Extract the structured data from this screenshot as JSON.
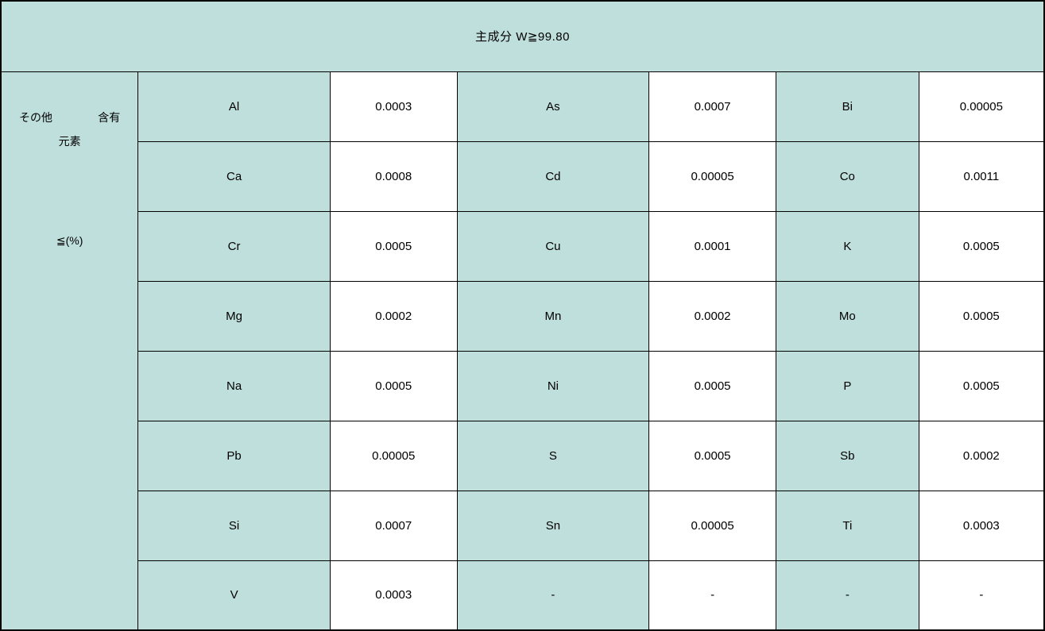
{
  "header": {
    "title": "主成分  W≧99.80"
  },
  "sideLabel": {
    "line1a": "その他",
    "line1b": "含有",
    "line2": "元素",
    "line3": "≦(%)"
  },
  "rows": [
    {
      "e1": "Al",
      "v1": "0.0003",
      "e2": "As",
      "v2": "0.0007",
      "e3": "Bi",
      "v3": "0.00005"
    },
    {
      "e1": "Ca",
      "v1": "0.0008",
      "e2": "Cd",
      "v2": "0.00005",
      "e3": "Co",
      "v3": "0.0011"
    },
    {
      "e1": "Cr",
      "v1": "0.0005",
      "e2": "Cu",
      "v2": "0.0001",
      "e3": "K",
      "v3": "0.0005"
    },
    {
      "e1": "Mg",
      "v1": "0.0002",
      "e2": "Mn",
      "v2": "0.0002",
      "e3": "Mo",
      "v3": "0.0005"
    },
    {
      "e1": "Na",
      "v1": "0.0005",
      "e2": "Ni",
      "v2": "0.0005",
      "e3": "P",
      "v3": "0.0005"
    },
    {
      "e1": "Pb",
      "v1": "0.00005",
      "e2": "S",
      "v2": "0.0005",
      "e3": "Sb",
      "v3": "0.0002"
    },
    {
      "e1": "Si",
      "v1": "0.0007",
      "e2": "Sn",
      "v2": "0.00005",
      "e3": "Ti",
      "v3": "0.0003"
    },
    {
      "e1": "V",
      "v1": "0.0003",
      "e2": "-",
      "v2": "-",
      "e3": "-",
      "v3": "-"
    }
  ]
}
